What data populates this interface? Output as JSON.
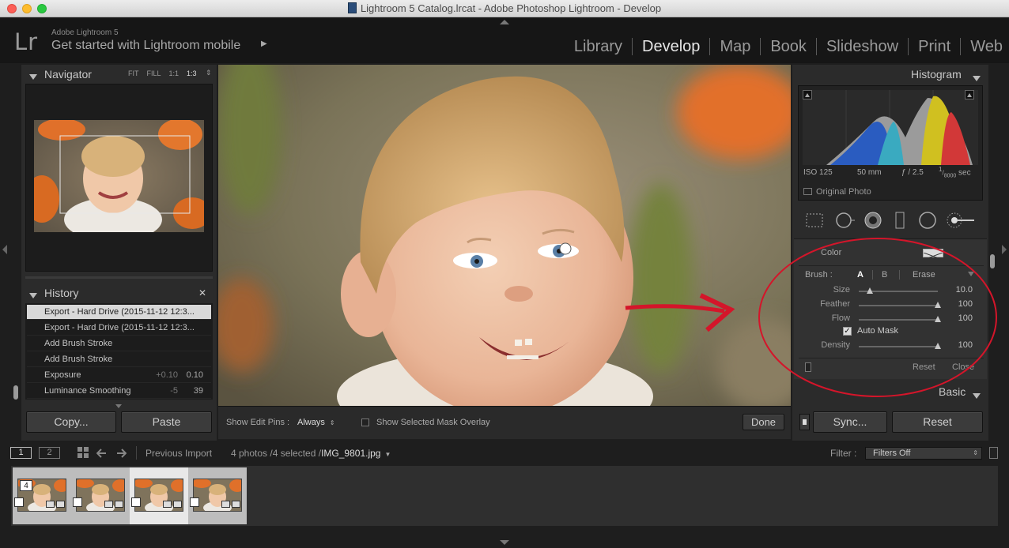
{
  "window": {
    "title": "Lightroom 5 Catalog.lrcat - Adobe Photoshop Lightroom - Develop"
  },
  "identity": {
    "logo": "Lr",
    "product": "Adobe Lightroom 5",
    "tagline": "Get started with Lightroom mobile",
    "arrow": "▶"
  },
  "modules": [
    {
      "label": "Library",
      "active": false
    },
    {
      "label": "Develop",
      "active": true
    },
    {
      "label": "Map",
      "active": false
    },
    {
      "label": "Book",
      "active": false
    },
    {
      "label": "Slideshow",
      "active": false
    },
    {
      "label": "Print",
      "active": false
    },
    {
      "label": "Web",
      "active": false
    }
  ],
  "navigator": {
    "title": "Navigator",
    "zooms": [
      "FIT",
      "FILL",
      "1:1",
      "1:3"
    ],
    "zoom_arrows": "⇕"
  },
  "history": {
    "title": "History",
    "close": "✕",
    "items": [
      {
        "label": "Export - Hard Drive (2015-11-12 12:3...",
        "v1": "",
        "v2": "",
        "selected": true
      },
      {
        "label": "Export - Hard Drive (2015-11-12 12:3...",
        "v1": "",
        "v2": "",
        "selected": false
      },
      {
        "label": "Add Brush Stroke",
        "v1": "",
        "v2": "",
        "selected": false
      },
      {
        "label": "Add Brush Stroke",
        "v1": "",
        "v2": "",
        "selected": false
      },
      {
        "label": "Exposure",
        "v1": "+0.10",
        "v2": "0.10",
        "selected": false
      },
      {
        "label": "Luminance Smoothing",
        "v1": "-5",
        "v2": "39",
        "selected": false
      }
    ]
  },
  "left_buttons": {
    "copy": "Copy...",
    "paste": "Paste"
  },
  "histogram": {
    "title": "Histogram",
    "iso": "ISO 125",
    "focal": "50 mm",
    "aperture": "ƒ / 2.5",
    "shutter_num": "1",
    "shutter_den": "8000",
    "shutter_unit": "sec",
    "original_photo": "Original Photo"
  },
  "tools": [
    "crop-overlay-icon",
    "spot-removal-icon",
    "red-eye-icon",
    "graduated-filter-icon",
    "radial-filter-icon",
    "adjustment-brush-icon"
  ],
  "brush": {
    "color_label": "Color",
    "brush_label": "Brush :",
    "tab_a": "A",
    "tab_b": "B",
    "tab_erase": "Erase",
    "size": {
      "label": "Size",
      "value": "10.0",
      "level": 0.1
    },
    "feather": {
      "label": "Feather",
      "value": "100",
      "level": 1.0
    },
    "flow": {
      "label": "Flow",
      "value": "100",
      "level": 1.0
    },
    "auto_mask": {
      "label": "Auto Mask",
      "checked": true
    },
    "density": {
      "label": "Density",
      "value": "100",
      "level": 1.0
    },
    "reset": "Reset",
    "close": "Close"
  },
  "basic": {
    "title": "Basic"
  },
  "right_buttons": {
    "sync": "Sync...",
    "reset": "Reset"
  },
  "toolbar": {
    "show_edit_pins": "Show Edit Pins :",
    "edit_pins_value": "Always",
    "mask_overlay": "Show Selected Mask Overlay",
    "done": "Done"
  },
  "filmstrip_bar": {
    "screen1": "1",
    "screen2": "2",
    "source": "Previous Import",
    "count": "4 photos /4 selected /",
    "filename": "IMG_9801.jpg",
    "filter_label": "Filter :",
    "filter_value": "Filters Off"
  },
  "filmstrip": {
    "badge": "4",
    "count": 4,
    "selected_index": 2
  },
  "colors": {
    "accent_red": "#d4152a",
    "panel": "#2b2b2b",
    "active_module": "#e6e6e6"
  }
}
